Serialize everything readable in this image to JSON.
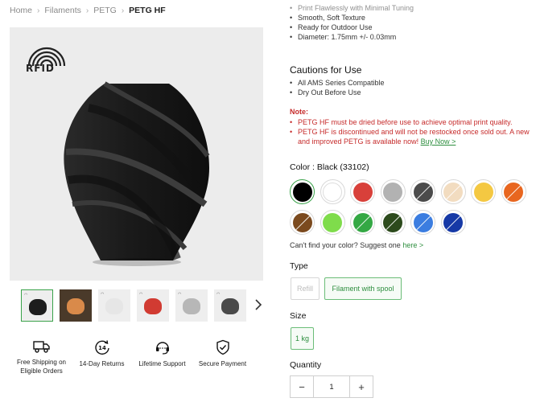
{
  "breadcrumb": {
    "home": "Home",
    "filaments": "Filaments",
    "petg": "PETG",
    "current": "PETG HF",
    "sep": "›"
  },
  "image": {
    "rfid_text": "RFID"
  },
  "thumbnails": [
    {
      "name": "black",
      "color": "#1d1d1d"
    },
    {
      "name": "multicolor",
      "color": "#d98a4a"
    },
    {
      "name": "white",
      "color": "#e6e6e6"
    },
    {
      "name": "red",
      "color": "#d13b32"
    },
    {
      "name": "gray",
      "color": "#b7b7b7"
    },
    {
      "name": "dark-gray",
      "color": "#4a4a4a"
    }
  ],
  "thumbs_next_icon": "chevron-right-icon",
  "features": [
    {
      "icon": "truck-icon",
      "label": "Free Shipping on Eligible Orders"
    },
    {
      "icon": "14-day-return-icon",
      "label": "14-Day Returns"
    },
    {
      "icon": "headset-icon",
      "label": "Lifetime Support"
    },
    {
      "icon": "shield-check-icon",
      "label": "Secure Payment"
    }
  ],
  "details": {
    "partial_top": "Print Flawlessly with Minimal Tuning",
    "items": [
      "Smooth, Soft Texture",
      "Ready for Outdoor Use",
      "Diameter: 1.75mm +/- 0.03mm"
    ]
  },
  "cautions": {
    "title": "Cautions for Use",
    "items": [
      "All AMS Series Compatible",
      "Dry Out Before Use"
    ]
  },
  "note": {
    "title": "Note:",
    "item1": "PETG HF must be dried before use to achieve optimal print quality.",
    "item2": "PETG HF is discontinued and will not be restocked once sold out. A new and improved PETG is available now!",
    "buy_now": "Buy Now >"
  },
  "color": {
    "label": "Color : Black (33102)",
    "swatches": [
      {
        "name": "black",
        "hex": "#000000",
        "selected": true,
        "slash": false
      },
      {
        "name": "white",
        "hex": "#ffffff",
        "selected": false,
        "slash": false
      },
      {
        "name": "red",
        "hex": "#d8403a",
        "selected": false,
        "slash": false
      },
      {
        "name": "gray",
        "hex": "#b2b2b2",
        "selected": false,
        "slash": false
      },
      {
        "name": "dark-gray",
        "hex": "#4b4b4b",
        "selected": false,
        "slash": true
      },
      {
        "name": "cream",
        "hex": "#f2dcc0",
        "selected": false,
        "slash": true
      },
      {
        "name": "yellow",
        "hex": "#f4c842",
        "selected": false,
        "slash": false
      },
      {
        "name": "orange",
        "hex": "#e8661f",
        "selected": false,
        "slash": true
      },
      {
        "name": "brown",
        "hex": "#7b4a1e",
        "selected": false,
        "slash": true
      },
      {
        "name": "lime-green",
        "hex": "#7fdc4b",
        "selected": false,
        "slash": false
      },
      {
        "name": "green",
        "hex": "#34a844",
        "selected": false,
        "slash": true
      },
      {
        "name": "dark-green",
        "hex": "#2c4a1c",
        "selected": false,
        "slash": true
      },
      {
        "name": "blue",
        "hex": "#3b7de0",
        "selected": false,
        "slash": true
      },
      {
        "name": "navy-blue",
        "hex": "#1639a6",
        "selected": false,
        "slash": true
      }
    ]
  },
  "suggest": {
    "text": "Can't find your color? Suggest one",
    "link": "here >"
  },
  "type": {
    "label": "Type",
    "options": [
      "Refill",
      "Filament with spool"
    ]
  },
  "size": {
    "label": "Size",
    "options": [
      "1 kg"
    ]
  },
  "quantity": {
    "label": "Quantity",
    "minus": "−",
    "plus": "+",
    "value": "1"
  },
  "accent": "#2d8e3e",
  "warning": "#c62b2b"
}
